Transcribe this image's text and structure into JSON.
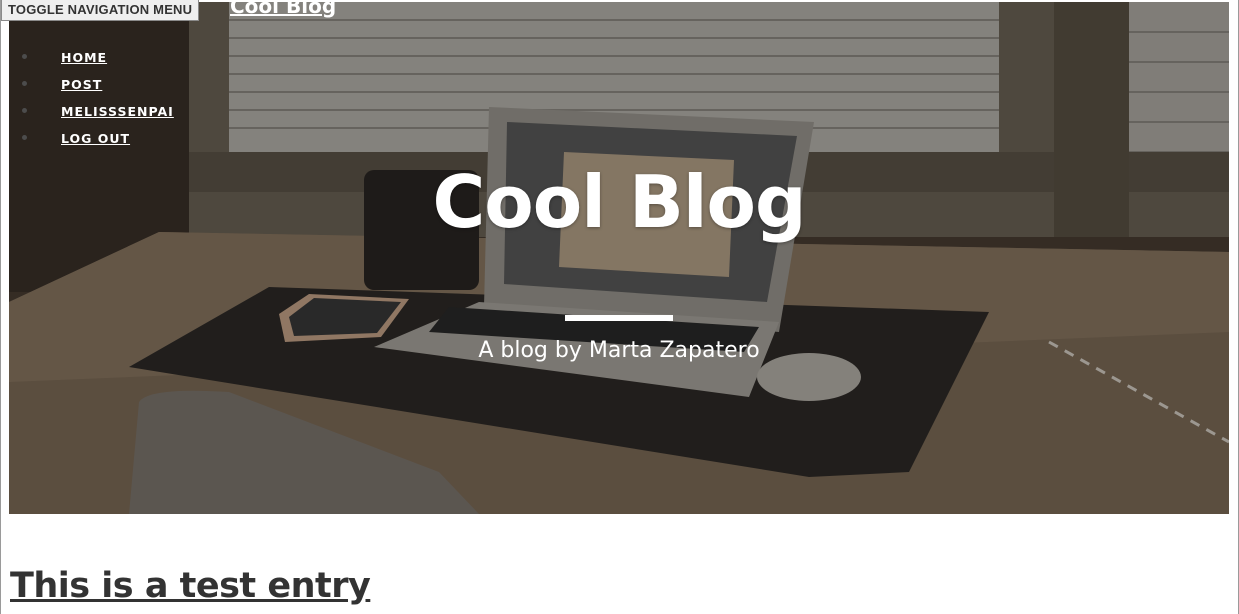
{
  "nav": {
    "toggle_label": "TOGGLE NAVIGATION MENU",
    "brand": "Cool Blog",
    "items": [
      {
        "label": "HOME"
      },
      {
        "label": "POST"
      },
      {
        "label": "MELISSSENPAI"
      },
      {
        "label": "LOG OUT"
      }
    ]
  },
  "hero": {
    "title": "Cool Blog",
    "subtitle": "A blog by Marta Zapatero"
  },
  "post": {
    "title": "This is a test entry"
  },
  "colors": {
    "hero_text": "#ffffff",
    "post_title": "#333333",
    "toggle_bg": "#efefef"
  }
}
